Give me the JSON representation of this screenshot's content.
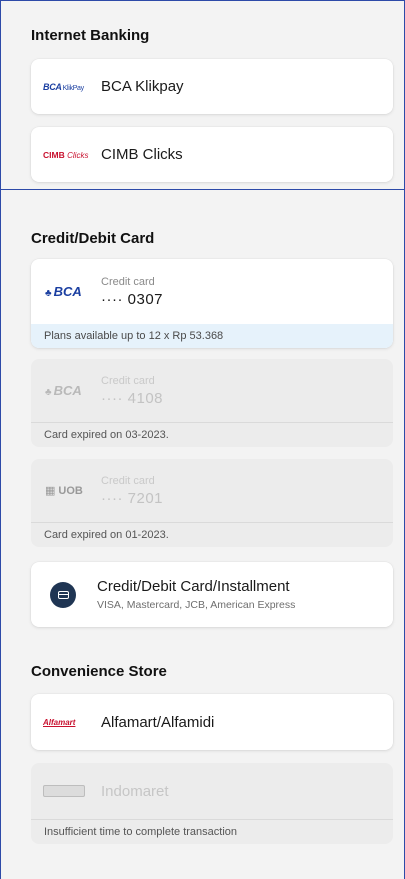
{
  "internet_banking": {
    "title": "Internet Banking",
    "options": [
      {
        "logo_text": "BCA",
        "logo_sub": "KlikPay",
        "name": "BCA Klikpay"
      },
      {
        "logo_text": "CIMB",
        "logo_sub": "Clicks",
        "name": "CIMB Clicks"
      }
    ]
  },
  "credit_debit": {
    "title": "Credit/Debit Card",
    "cards": [
      {
        "bank": "BCA",
        "type": "Credit card",
        "number": "···· 0307",
        "note": "Plans available up to 12 x Rp 53.368",
        "enabled": true
      },
      {
        "bank": "BCA",
        "type": "Credit card",
        "number": "···· 4108",
        "note": "Card expired on 03-2023.",
        "enabled": false
      },
      {
        "bank": "UOB",
        "type": "Credit card",
        "number": "···· 7201",
        "note": "Card expired on 01-2023.",
        "enabled": false
      }
    ],
    "new_card": {
      "title": "Credit/Debit Card/Installment",
      "subtitle": "VISA, Mastercard, JCB, American Express",
      "icon": "credit-card-icon"
    }
  },
  "convenience_store": {
    "title": "Convenience Store",
    "options": [
      {
        "logo_text": "Alfamart",
        "name": "Alfamart/Alfamidi",
        "enabled": true
      },
      {
        "name": "Indomaret",
        "note": "Insufficient time to complete transaction",
        "enabled": false
      }
    ]
  },
  "colors": {
    "frame": "#2d4aa8",
    "bca_blue": "#1b3fa1",
    "cimb_red": "#c8102e",
    "icon_navy": "#1f3553",
    "plan_note_bg": "#e6f2fb"
  }
}
